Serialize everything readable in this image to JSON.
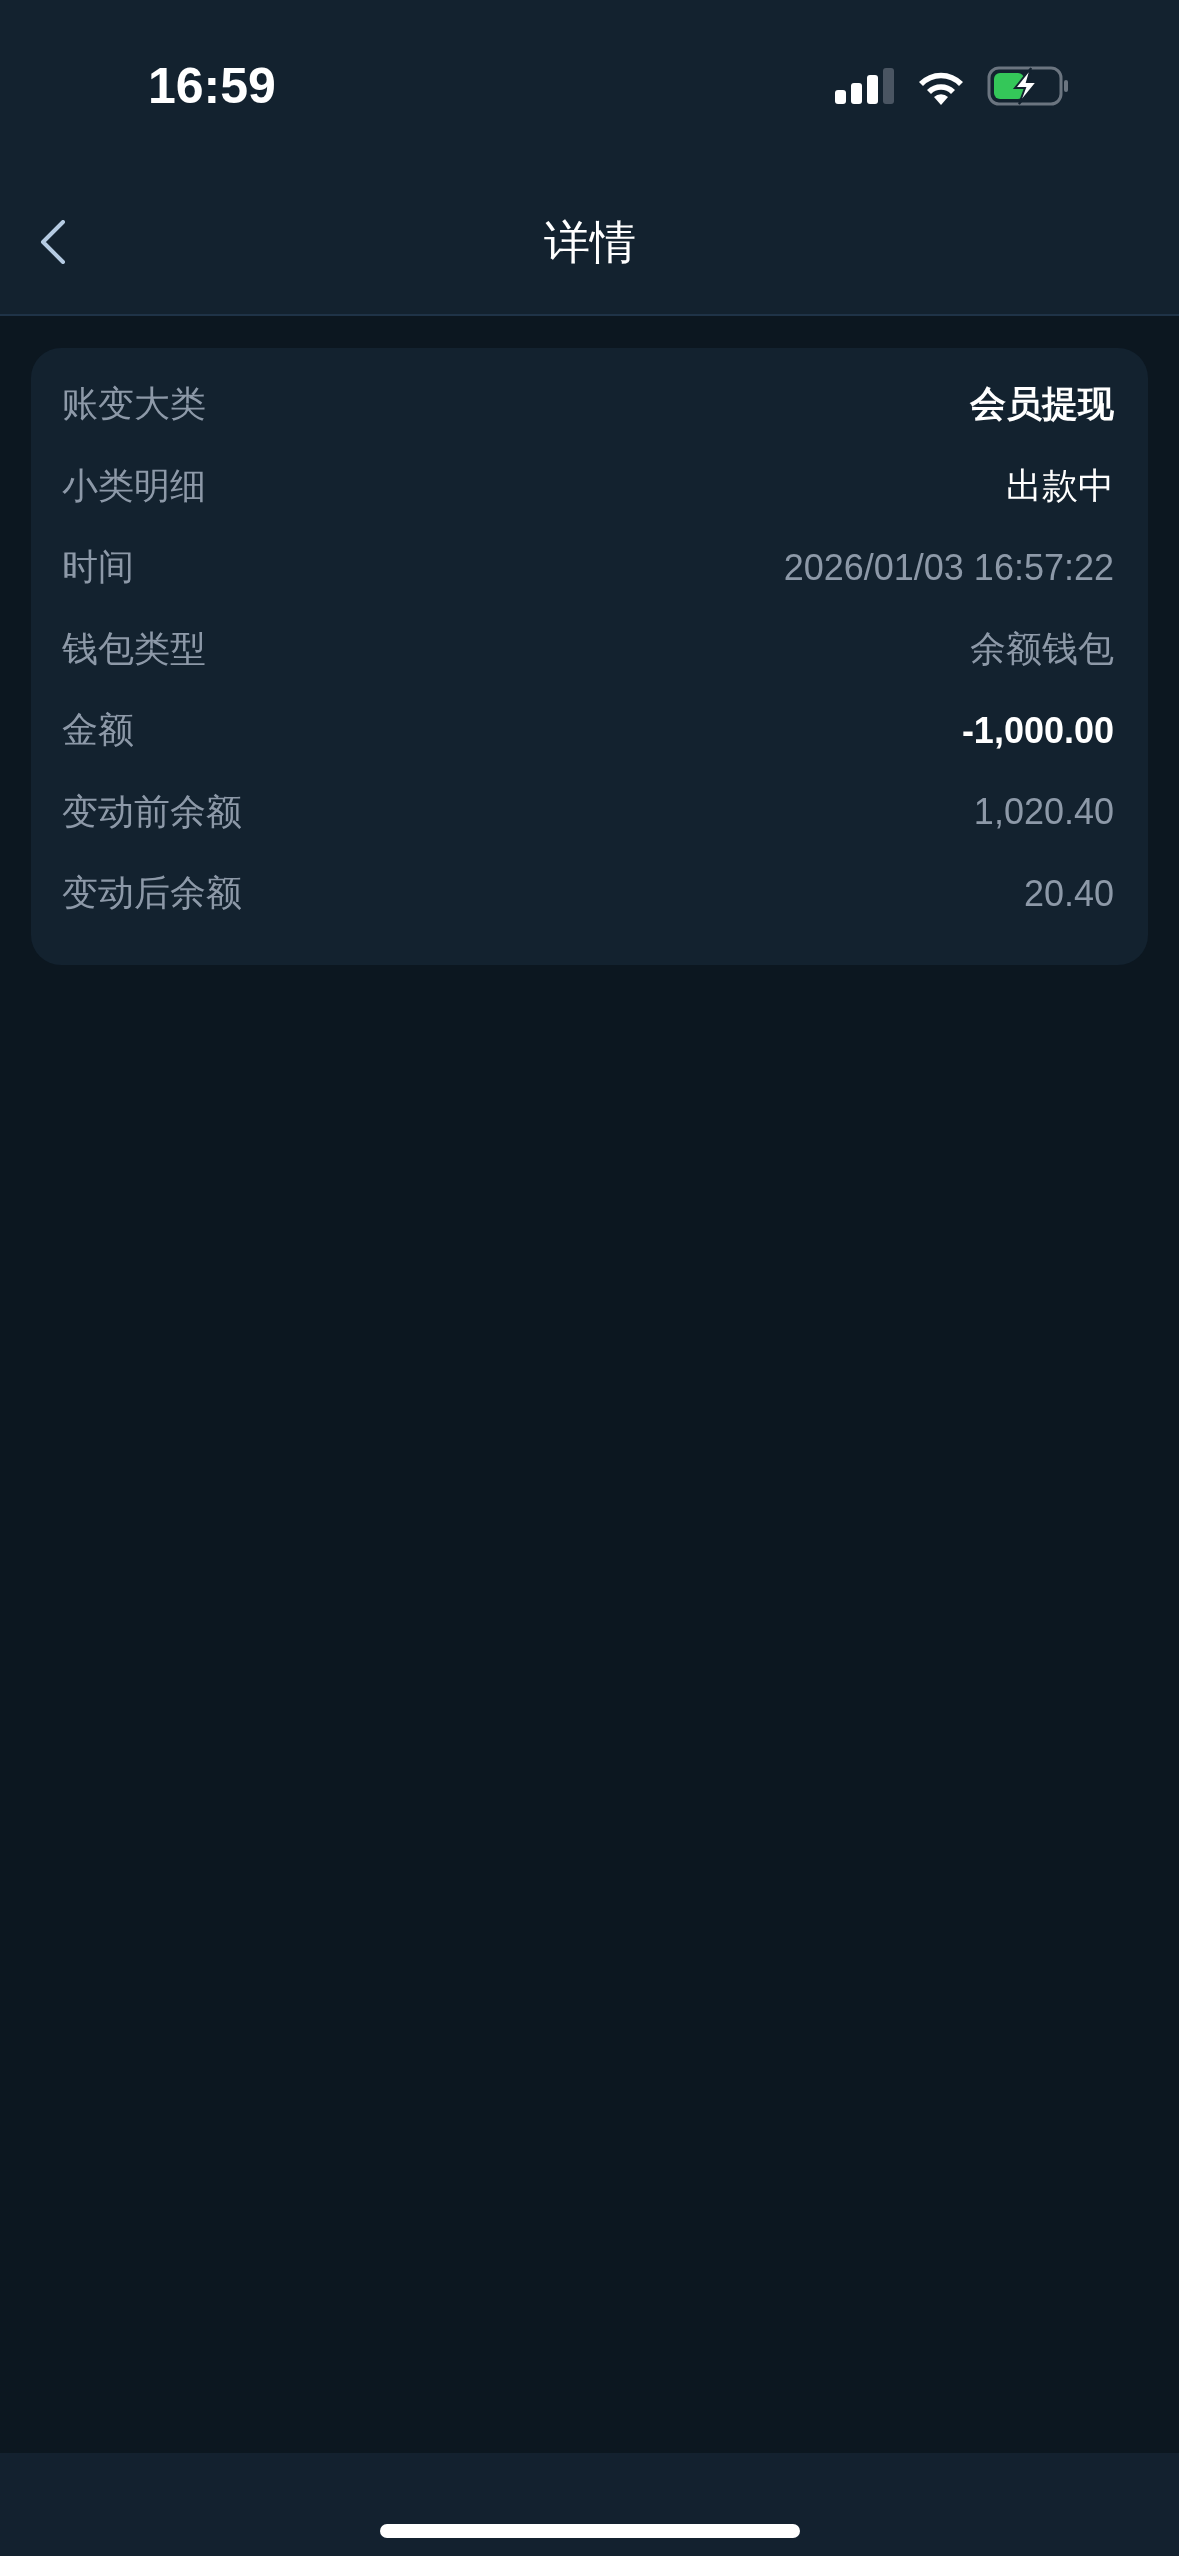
{
  "status_bar": {
    "time": "16:59"
  },
  "nav": {
    "title": "详情"
  },
  "details": [
    {
      "label": "账变大类",
      "value": "会员提现",
      "kind": "strong"
    },
    {
      "label": "小类明细",
      "value": "出款中",
      "kind": "plain"
    },
    {
      "label": "时间",
      "value": "2026/01/03 16:57:22",
      "kind": "muted"
    },
    {
      "label": "钱包类型",
      "value": "余额钱包",
      "kind": "muted"
    },
    {
      "label": "金额",
      "value": "-1,000.00",
      "kind": "strong"
    },
    {
      "label": "变动前余额",
      "value": "1,020.40",
      "kind": "muted"
    },
    {
      "label": "变动后余额",
      "value": "20.40",
      "kind": "muted"
    }
  ]
}
